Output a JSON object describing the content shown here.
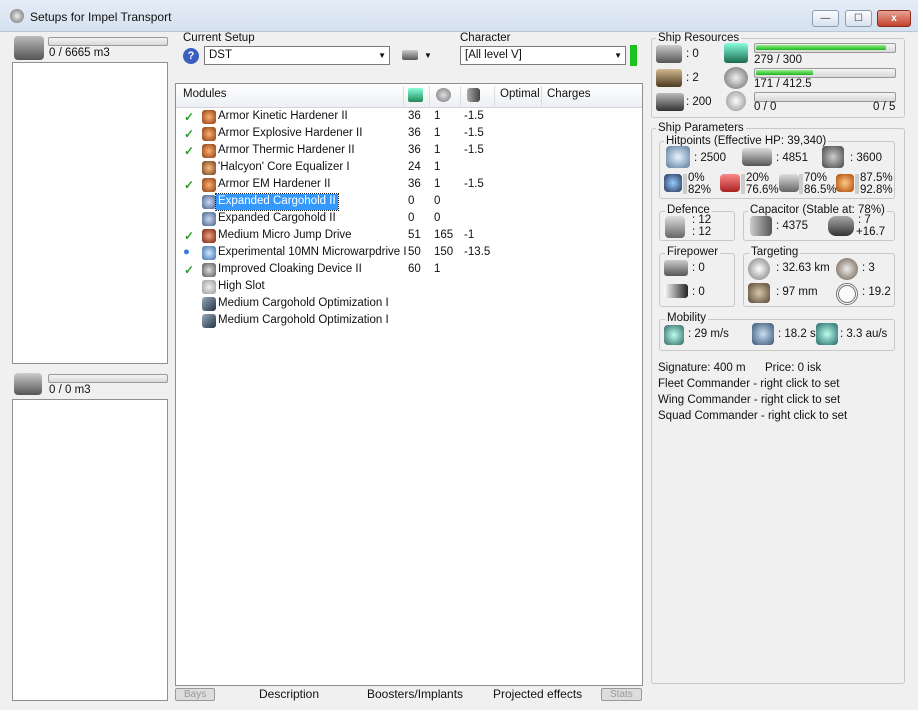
{
  "window": {
    "title": "Setups for Impel Transport",
    "min": "—",
    "max": "☐",
    "close": "x"
  },
  "cargo": {
    "top_capacity": "0 / 6665 m3",
    "bottom_capacity": "0 / 0 m3"
  },
  "setup": {
    "label": "Current Setup",
    "help_icon": "?",
    "value": "DST"
  },
  "character": {
    "label": "Character",
    "value": "[All level V]",
    "status_color": "#1ec21e"
  },
  "modules": {
    "headers": {
      "modules": "Modules",
      "optimal": "Optimal",
      "charges": "Charges"
    },
    "rows": [
      {
        "check": "✓",
        "name": "Armor Kinetic Hardener II",
        "cpu": "36",
        "pg": "1",
        "cap": "-1.5"
      },
      {
        "check": "✓",
        "name": "Armor Explosive Hardener II",
        "cpu": "36",
        "pg": "1",
        "cap": "-1.5"
      },
      {
        "check": "✓",
        "name": "Armor Thermic Hardener II",
        "cpu": "36",
        "pg": "1",
        "cap": "-1.5"
      },
      {
        "check": "",
        "name": "'Halcyon' Core Equalizer I",
        "cpu": "24",
        "pg": "1",
        "cap": ""
      },
      {
        "check": "✓",
        "name": "Armor EM Hardener II",
        "cpu": "36",
        "pg": "1",
        "cap": "-1.5"
      },
      {
        "check": "",
        "name": "Expanded Cargohold II",
        "cpu": "0",
        "pg": "0",
        "cap": ""
      },
      {
        "check": "",
        "name": "Expanded Cargohold II",
        "cpu": "0",
        "pg": "0",
        "cap": ""
      },
      {
        "check": "✓",
        "name": "Medium Micro Jump Drive",
        "cpu": "51",
        "pg": "165",
        "cap": "-1"
      },
      {
        "check": "●",
        "name": "Experimental 10MN Microwarpdrive I",
        "cpu": "50",
        "pg": "150",
        "cap": "-13.5"
      },
      {
        "check": "✓",
        "name": "Improved Cloaking Device II",
        "cpu": "60",
        "pg": "1",
        "cap": ""
      },
      {
        "check": "",
        "name": "High Slot",
        "cpu": "",
        "pg": "",
        "cap": ""
      },
      {
        "check": "",
        "name": "Medium Cargohold Optimization I",
        "cpu": "",
        "pg": "",
        "cap": ""
      },
      {
        "check": "",
        "name": "Medium Cargohold Optimization I",
        "cpu": "",
        "pg": "",
        "cap": ""
      }
    ]
  },
  "bottom_tabs": {
    "bays": "Bays",
    "description": "Description",
    "boosters": "Boosters/Implants",
    "projected": "Projected effects",
    "stats": "Stats"
  },
  "resources": {
    "label": "Ship Resources",
    "turrets": ": 0",
    "launchers": ": 2",
    "calibration": ": 200",
    "cpu": "279 / 300",
    "cpu_fraction": 0.93,
    "powergrid": "171 / 412.5",
    "pg_fraction": 0.41,
    "drones_left": "0 / 0",
    "drones_right": "0 / 5"
  },
  "params": {
    "label": "Ship Parameters",
    "hitpoints_label": "Hitpoints (Effective HP: 39,340)",
    "shield_hp": ": 2500",
    "armor_hp": ": 4851",
    "structure_hp": ": 3600",
    "resists": [
      [
        "0%",
        "82%"
      ],
      [
        "20%",
        "76.6%"
      ],
      [
        "70%",
        "86.5%"
      ],
      [
        "87.5%",
        "92.8%"
      ]
    ],
    "defence_label": "Defence",
    "defence_a": ": 12",
    "defence_b": ": 12",
    "capacitor_label": "Capacitor (Stable at: 78%)",
    "cap_amount": ": 4375",
    "cap_a": ": 7",
    "cap_b": "+16.7",
    "firepower_label": "Firepower",
    "fire_a": ": 0",
    "fire_b": ": 0",
    "targeting_label": "Targeting",
    "range": ": 32.63 km",
    "targets": ": 3",
    "scan": ": 97 mm",
    "sensor": ": 19.2",
    "mobility_label": "Mobility",
    "speed": ": 29 m/s",
    "align": ": 18.2 s",
    "warp": ": 3.3 au/s",
    "signature": "Signature: 400 m",
    "price": "Price: 0 isk",
    "fleet": "Fleet Commander - right click to set",
    "wing": "Wing Commander - right click to set",
    "squad": "Squad Commander - right click to set"
  }
}
